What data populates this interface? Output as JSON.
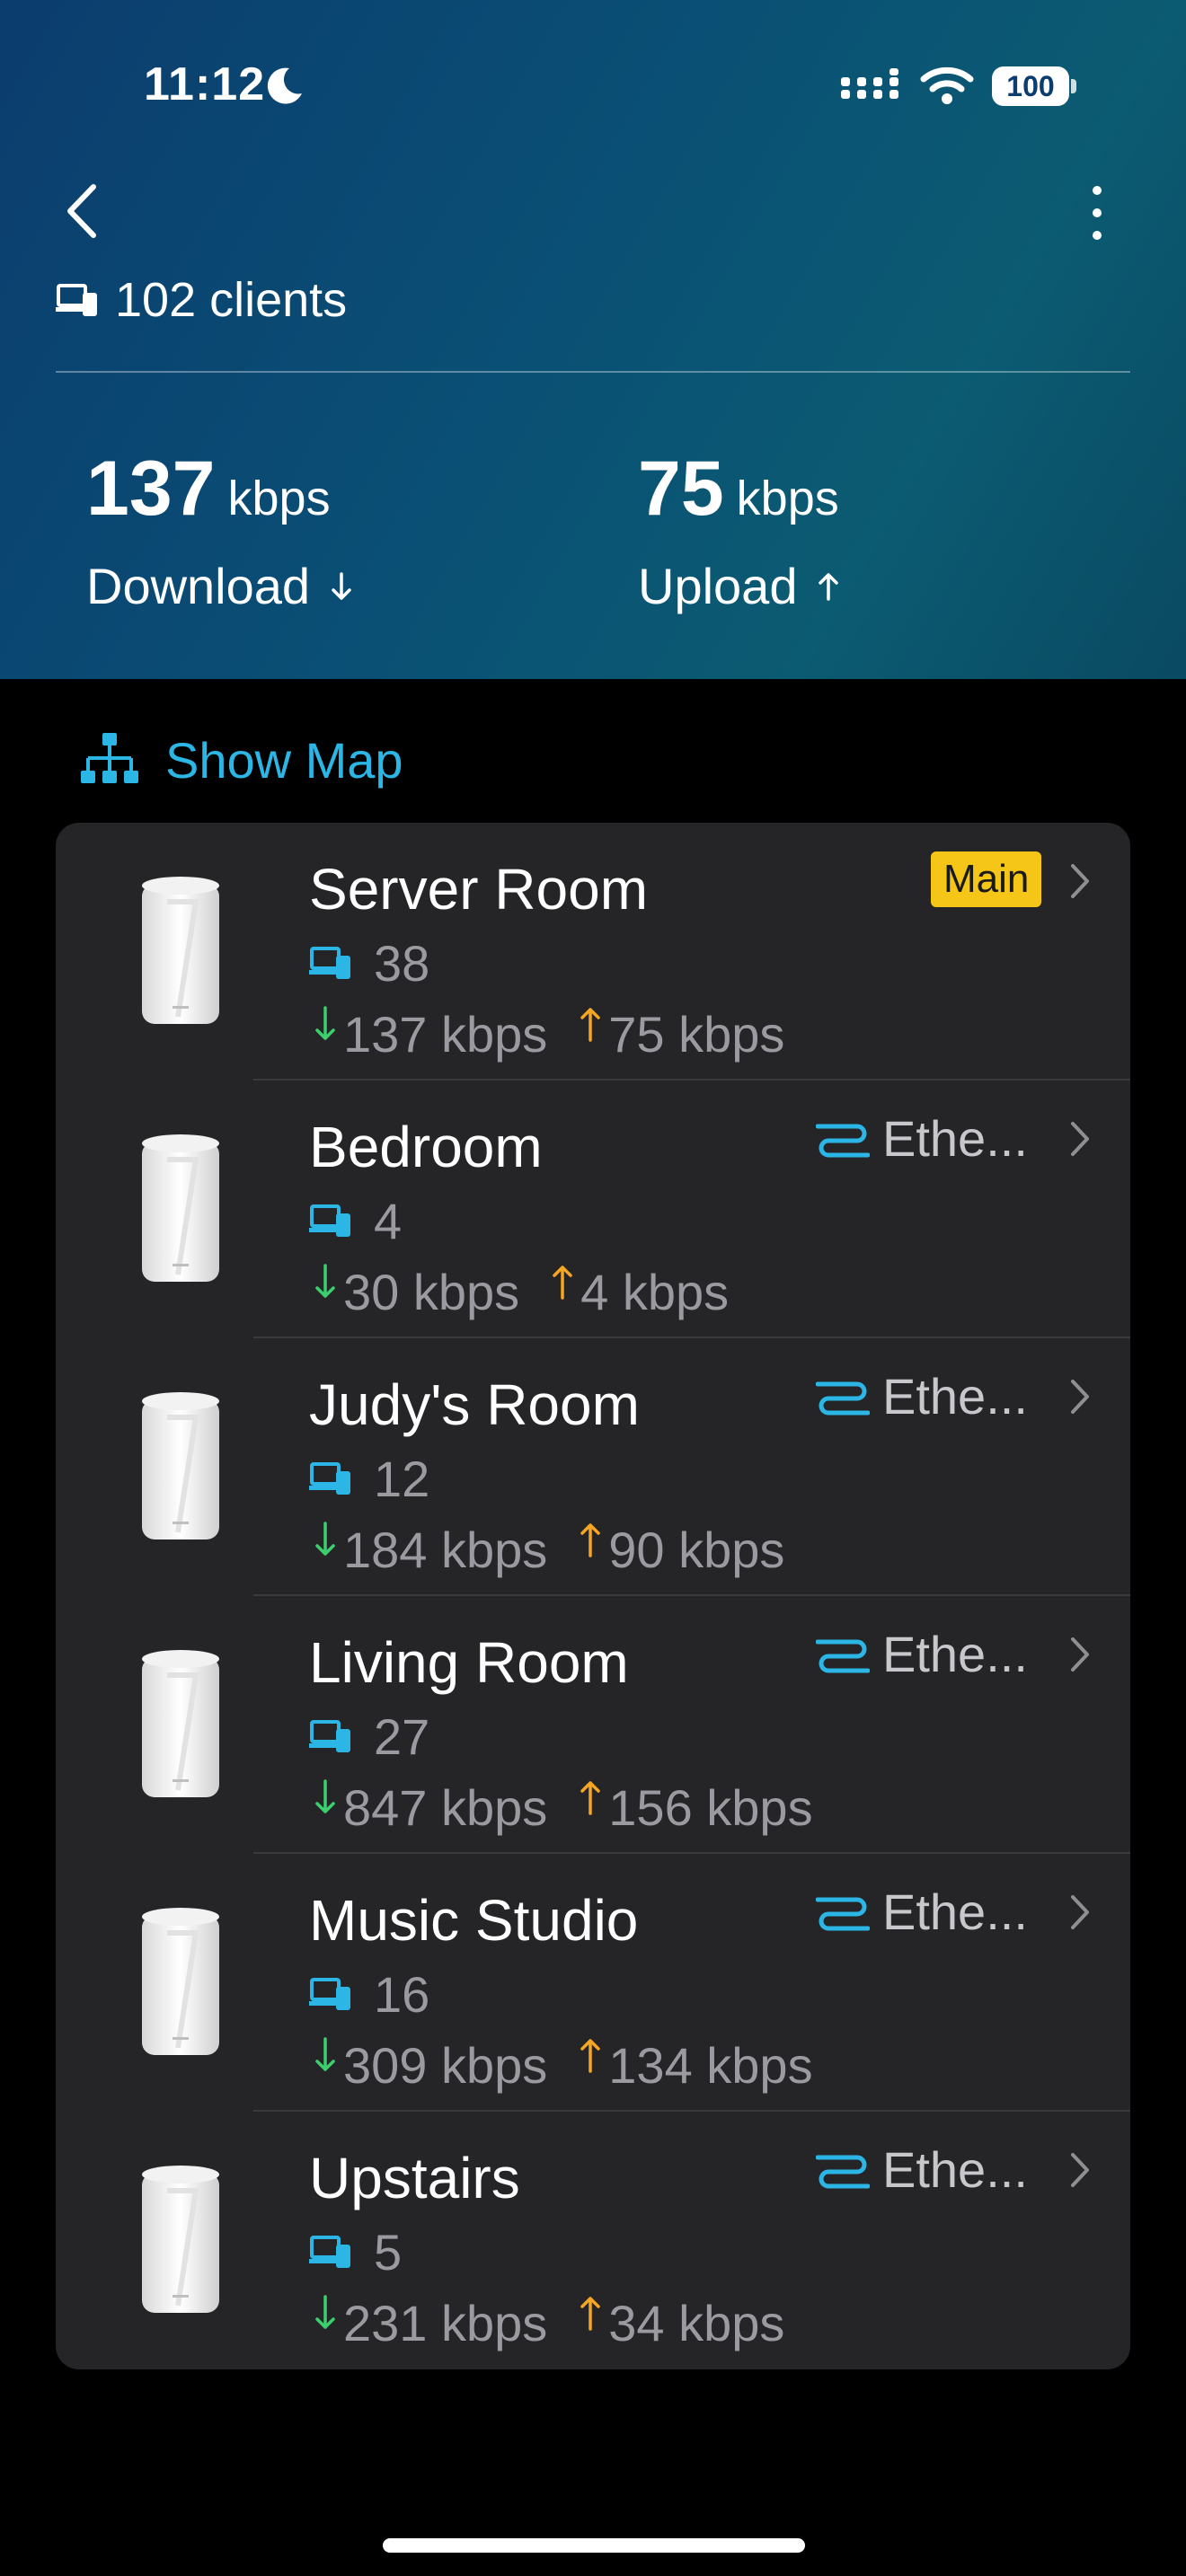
{
  "status_bar": {
    "time": "11:12",
    "battery": "100",
    "icons": [
      "moon-icon",
      "cellular-signal-icon",
      "wifi-icon",
      "battery-icon"
    ]
  },
  "header": {
    "clients_label": "102 clients",
    "download": {
      "value": "137",
      "unit": "kbps",
      "label": "Download"
    },
    "upload": {
      "value": "75",
      "unit": "kbps",
      "label": "Upload"
    }
  },
  "show_map_label": "Show Map",
  "colors": {
    "accent": "#2bb6e6",
    "download_arrow": "#3ccf6e",
    "upload_arrow": "#f5a623",
    "main_badge": "#f5c518"
  },
  "devices": [
    {
      "name": "Server Room",
      "clients": "38",
      "down": "137 kbps",
      "up": "75 kbps",
      "badge": "Main",
      "connection": ""
    },
    {
      "name": "Bedroom",
      "clients": "4",
      "down": "30 kbps",
      "up": "4 kbps",
      "badge": "",
      "connection": "Ethe..."
    },
    {
      "name": "Judy's Room",
      "clients": "12",
      "down": "184 kbps",
      "up": "90 kbps",
      "badge": "",
      "connection": "Ethe..."
    },
    {
      "name": "Living Room",
      "clients": "27",
      "down": "847 kbps",
      "up": "156 kbps",
      "badge": "",
      "connection": "Ethe..."
    },
    {
      "name": "Music Studio",
      "clients": "16",
      "down": "309 kbps",
      "up": "134 kbps",
      "badge": "",
      "connection": "Ethe..."
    },
    {
      "name": "Upstairs",
      "clients": "5",
      "down": "231 kbps",
      "up": "34 kbps",
      "badge": "",
      "connection": "Ethe..."
    }
  ]
}
